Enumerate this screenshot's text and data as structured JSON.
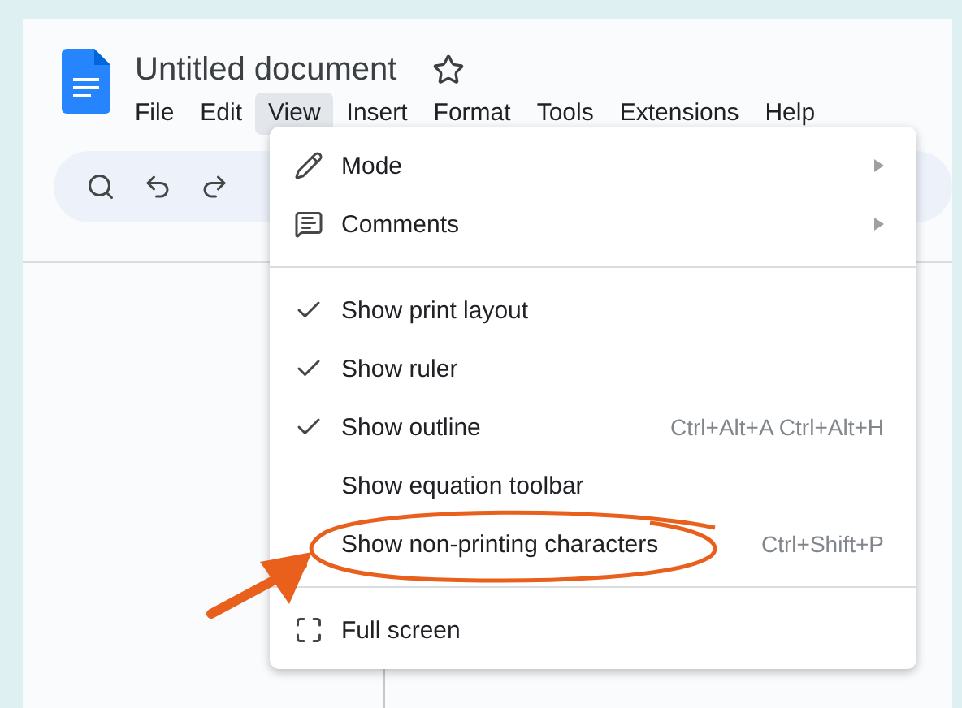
{
  "document": {
    "title": "Untitled document",
    "starred": false
  },
  "menu_bar": [
    {
      "label": "File",
      "selected": false
    },
    {
      "label": "Edit",
      "selected": false
    },
    {
      "label": "View",
      "selected": true
    },
    {
      "label": "Insert",
      "selected": false
    },
    {
      "label": "Format",
      "selected": false
    },
    {
      "label": "Tools",
      "selected": false
    },
    {
      "label": "Extensions",
      "selected": false
    },
    {
      "label": "Help",
      "selected": false
    }
  ],
  "view_menu": {
    "groups": [
      [
        {
          "kind": "submenu",
          "label": "Mode"
        },
        {
          "kind": "submenu",
          "label": "Comments"
        }
      ],
      [
        {
          "kind": "toggle",
          "label": "Show print layout",
          "checked": true
        },
        {
          "kind": "toggle",
          "label": "Show ruler",
          "checked": true
        },
        {
          "kind": "toggle",
          "label": "Show outline",
          "checked": true,
          "shortcut": "Ctrl+Alt+A Ctrl+Alt+H"
        },
        {
          "kind": "toggle",
          "label": "Show equation toolbar",
          "checked": false
        },
        {
          "kind": "toggle",
          "label": "Show non-printing characters",
          "checked": false,
          "shortcut": "Ctrl+Shift+P"
        }
      ],
      [
        {
          "kind": "action",
          "label": "Full screen"
        }
      ]
    ]
  }
}
